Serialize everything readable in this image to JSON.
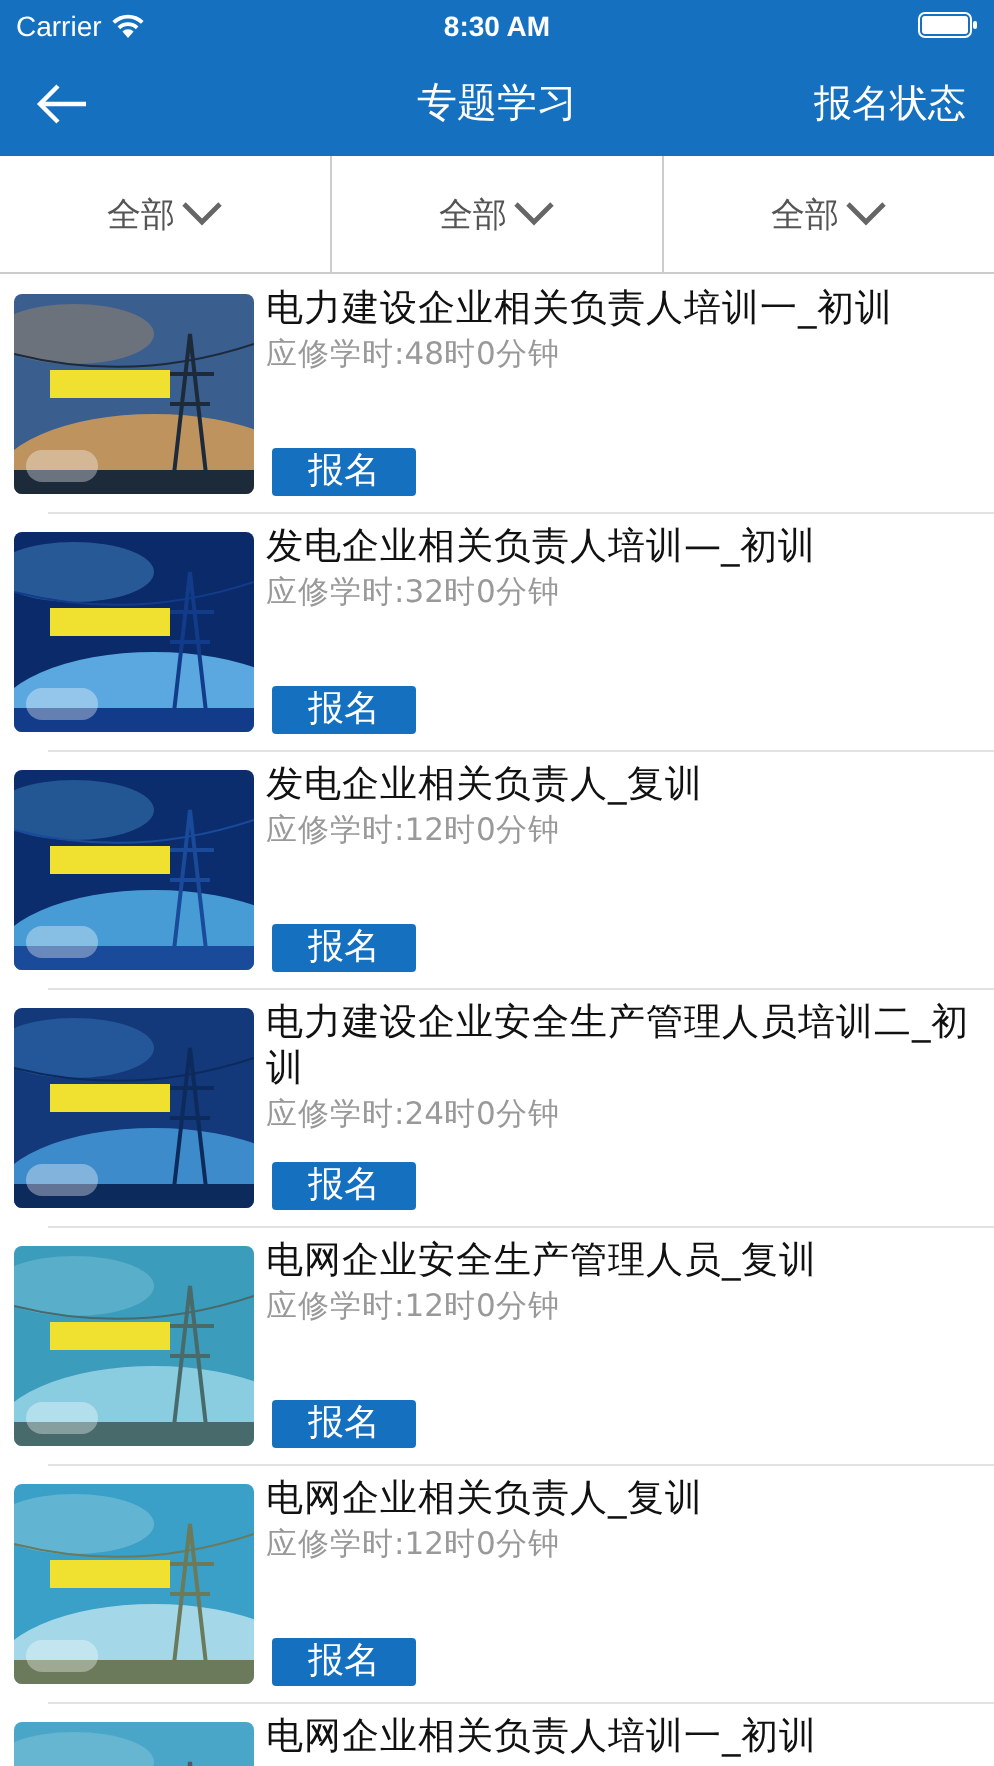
{
  "status_bar": {
    "carrier": "Carrier",
    "time": "8:30 AM"
  },
  "nav": {
    "title": "专题学习",
    "action": "报名状态"
  },
  "filters": [
    {
      "label": "全部"
    },
    {
      "label": "全部"
    },
    {
      "label": "全部"
    }
  ],
  "courses": [
    {
      "title": "电力建设企业相关负责人培训一_初训",
      "hours": "应修学时:48时0分钟",
      "button": "报名"
    },
    {
      "title": "发电企业相关负责人培训—_初训",
      "hours": "应修学时:32时0分钟",
      "button": "报名"
    },
    {
      "title": "发电企业相关负责人_复训",
      "hours": "应修学时:12时0分钟",
      "button": "报名"
    },
    {
      "title": "电力建设企业安全生产管理人员培训二_初训",
      "hours": "应修学时:24时0分钟",
      "button": "报名"
    },
    {
      "title": "电网企业安全生产管理人员_复训",
      "hours": "应修学时:12时0分钟",
      "button": "报名"
    },
    {
      "title": "电网企业相关负责人_复训",
      "hours": "应修学时:12时0分钟",
      "button": "报名"
    },
    {
      "title": "电网企业相关负责人培训一_初训"
    }
  ]
}
